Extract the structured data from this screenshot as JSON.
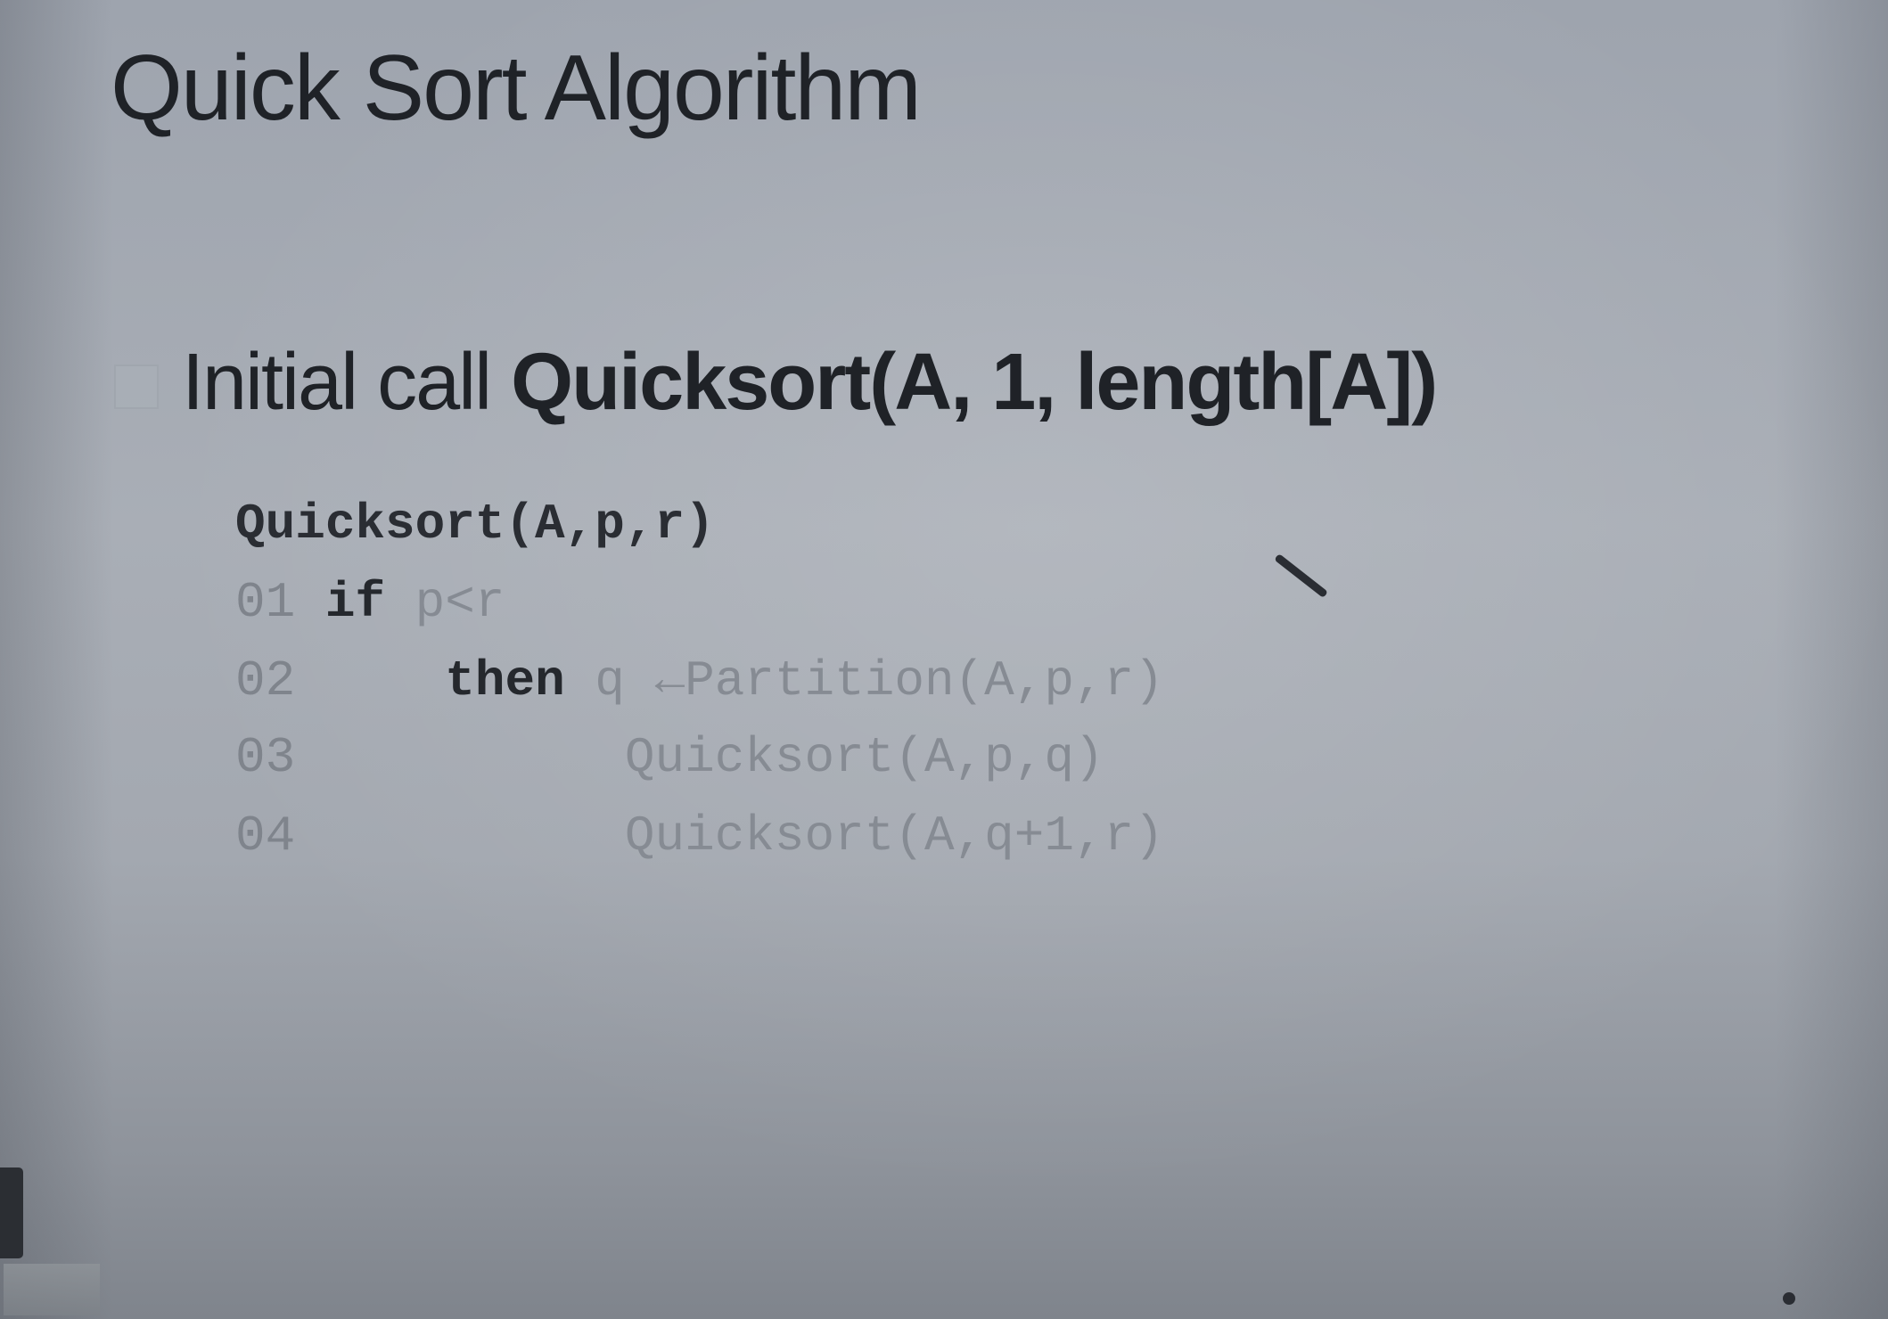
{
  "slide": {
    "title": "Quick Sort Algorithm",
    "bullet": {
      "prefix": "Initial call ",
      "call": "Quicksort(A, 1, length[A])"
    },
    "code": {
      "header": "Quicksort(A,p,r)",
      "lines": [
        {
          "num": "01",
          "indent": " ",
          "keyword": "if",
          "rest": " p<r"
        },
        {
          "num": "02",
          "indent": "     ",
          "keyword": "then",
          "rest": " q ←Partition(A,p,r)"
        },
        {
          "num": "03",
          "indent": "           ",
          "keyword": "",
          "rest": "Quicksort(A,p,q)"
        },
        {
          "num": "04",
          "indent": "           ",
          "keyword": "",
          "rest": "Quicksort(A,q+1,r)"
        }
      ]
    }
  },
  "colors": {
    "background": "#a9aeb6",
    "text_dark": "#1f2227",
    "text_faint": "#868b93"
  }
}
